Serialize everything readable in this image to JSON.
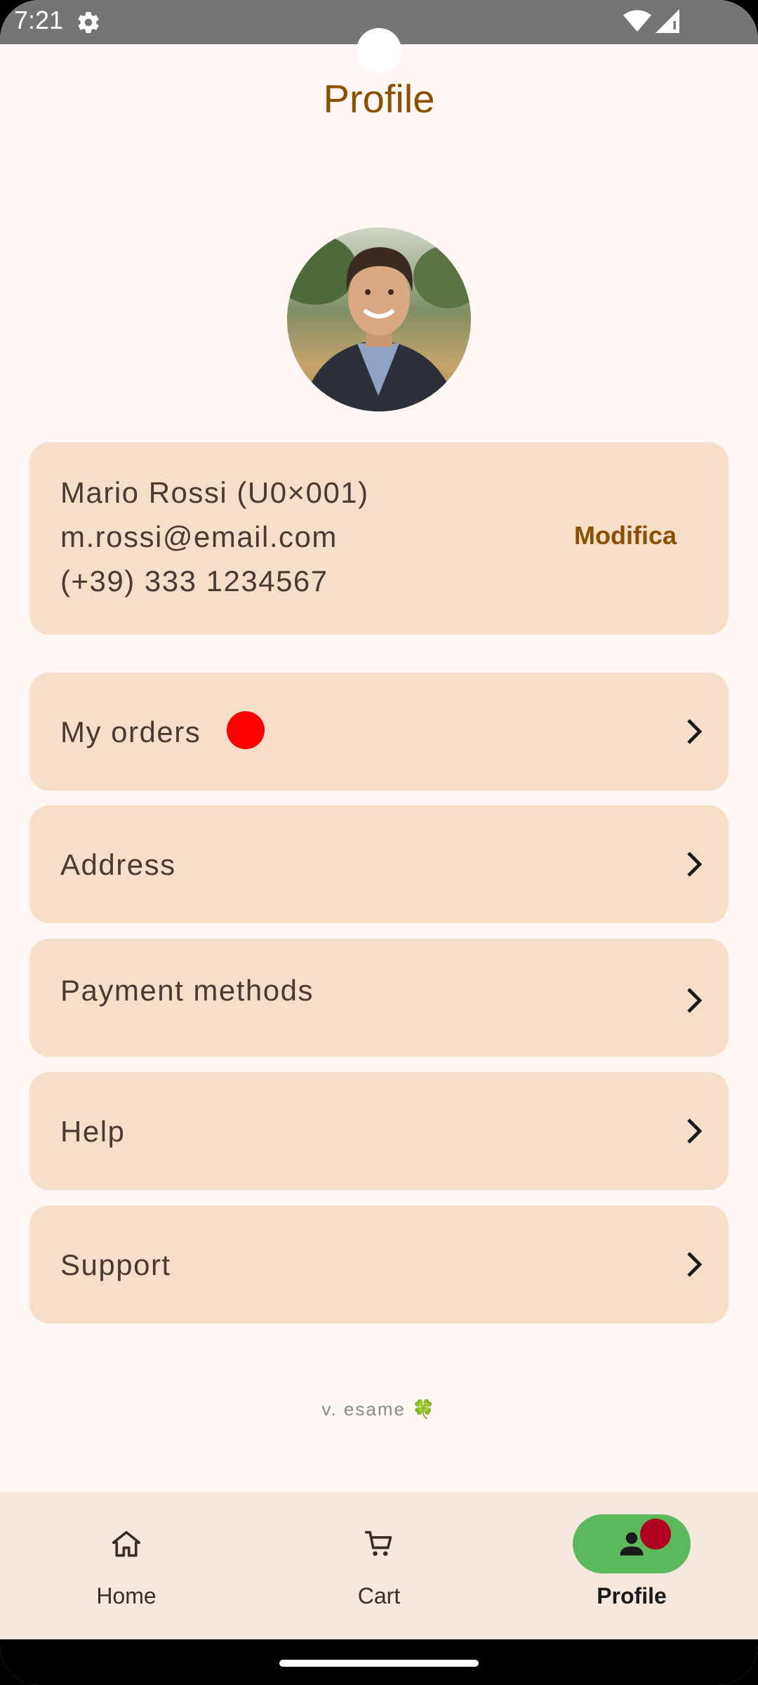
{
  "status_bar": {
    "time": "7:21",
    "icons": [
      "gear-icon",
      "wifi-icon",
      "signal-icon"
    ]
  },
  "header": {
    "title": "Profile"
  },
  "profile": {
    "avatar": "avatar-photo",
    "name": "Mario Rossi (U0×001)",
    "email": "m.rossi@email.com",
    "phone": "(+39) 333 1234567",
    "edit_label": "Modifica"
  },
  "menu": {
    "items": [
      {
        "label": "My orders",
        "has_badge": true,
        "icon": "chevron-right-icon"
      },
      {
        "label": "Address",
        "icon": "chevron-right-icon"
      },
      {
        "label": "Payment methods",
        "icon": "chevron-right-icon"
      },
      {
        "label": "Help",
        "icon": "chevron-right-icon"
      },
      {
        "label": "Support",
        "icon": "chevron-right-icon"
      }
    ]
  },
  "footer": {
    "version": "v. esame",
    "version_icon": "🍀"
  },
  "bottom_nav": {
    "items": [
      {
        "label": "Home",
        "icon": "home-icon",
        "active": false
      },
      {
        "label": "Cart",
        "icon": "cart-icon",
        "active": false
      },
      {
        "label": "Profile",
        "icon": "person-icon",
        "active": true,
        "has_badge": true
      }
    ]
  },
  "colors": {
    "accent": "#8a4f00",
    "card_bg": "#f7dec9",
    "page_bg": "#fff7f3",
    "nav_bg": "#f4e8df",
    "active_pill": "#5cb85c",
    "badge_red": "#ff0000",
    "nav_badge": "#b00020"
  }
}
